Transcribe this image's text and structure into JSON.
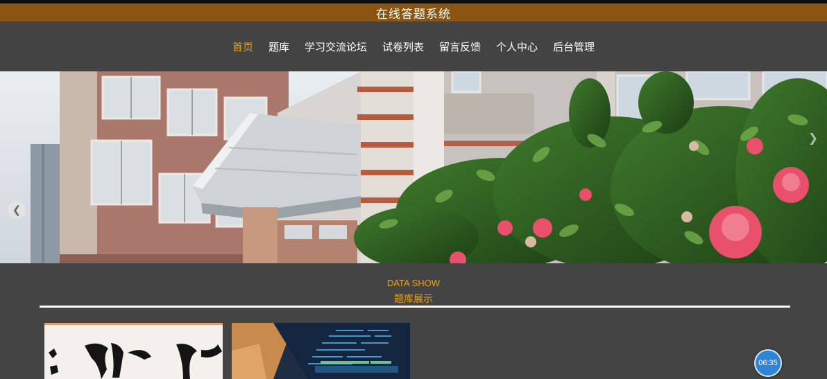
{
  "header": {
    "title": "在线答题系统"
  },
  "nav": {
    "items": [
      {
        "label": "首页",
        "active": true
      },
      {
        "label": "题库",
        "active": false
      },
      {
        "label": "学习交流论坛",
        "active": false
      },
      {
        "label": "试卷列表",
        "active": false
      },
      {
        "label": "留言反馈",
        "active": false
      },
      {
        "label": "个人中心",
        "active": false
      },
      {
        "label": "后台管理",
        "active": false
      }
    ]
  },
  "banner": {
    "prev_icon": "chevron-left-icon",
    "next_icon": "chevron-right-icon"
  },
  "section": {
    "title": "DATA SHOW",
    "subtitle": "题库展示"
  },
  "timer": {
    "time": "06:35"
  },
  "colors": {
    "title_bar": "#8a5511",
    "accent": "#e5a31f",
    "nav_bg": "#434343",
    "page_bg": "#444444",
    "timer": "#2f84d8"
  }
}
